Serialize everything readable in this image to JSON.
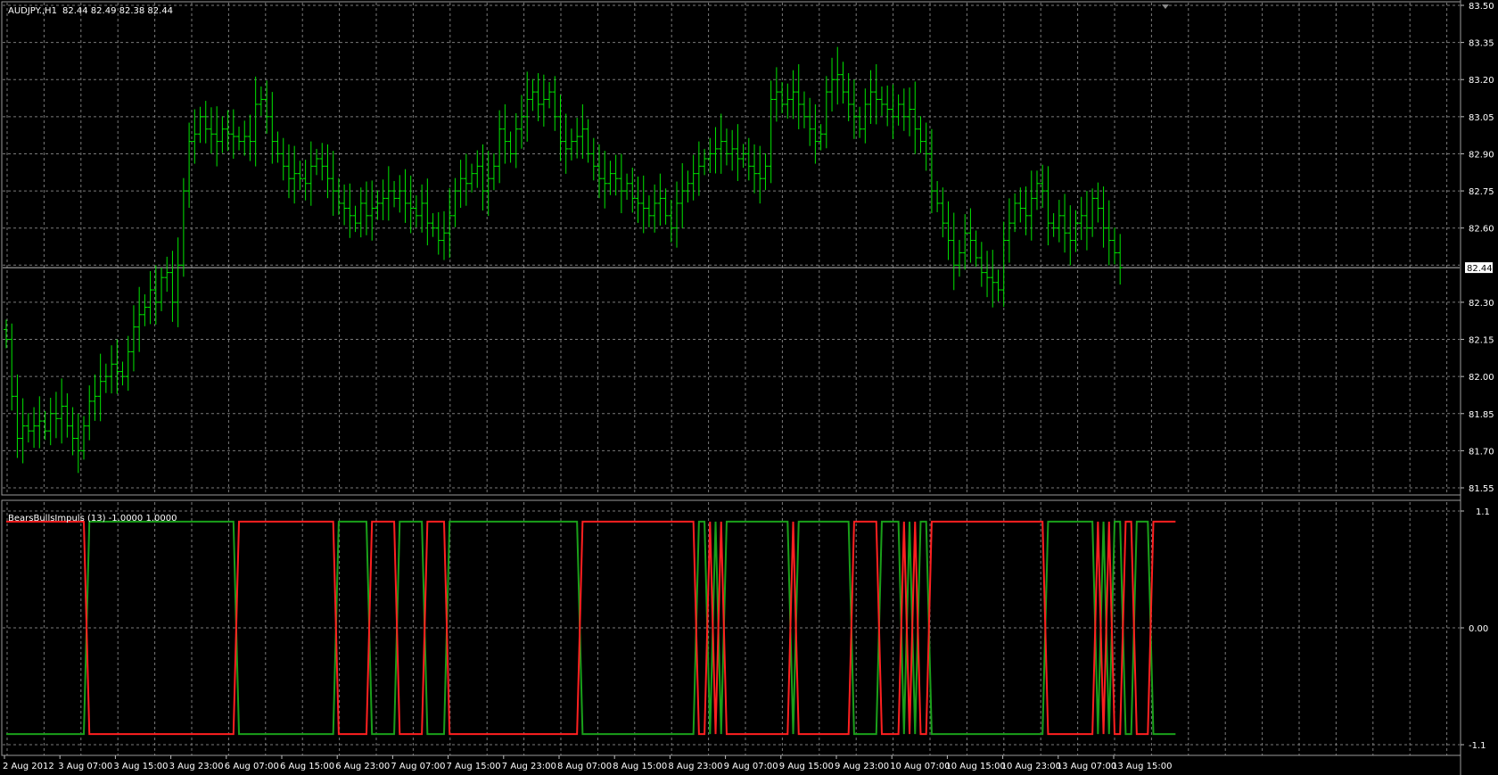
{
  "main_chart": {
    "symbol_header": "AUDJPY.,H1",
    "ohlc_header": "82.44 82.49 82.38 82.44",
    "current_price_label": "82.44",
    "y_ticks": [
      "83.50",
      "83.35",
      "83.20",
      "83.05",
      "82.90",
      "82.75",
      "82.60",
      "82.30",
      "82.15",
      "82.00",
      "81.85",
      "81.70",
      "81.55"
    ]
  },
  "indicator": {
    "header": "BearsBullsImpuls (13) -1.0000 1.0000",
    "y_ticks": [
      "1.1",
      "0.00",
      "-1.1"
    ]
  },
  "x_ticks": [
    "2 Aug 2012",
    "3 Aug 07:00",
    "3 Aug 15:00",
    "3 Aug 23:00",
    "6 Aug 07:00",
    "6 Aug 15:00",
    "6 Aug 23:00",
    "7 Aug 07:00",
    "7 Aug 15:00",
    "7 Aug 23:00",
    "8 Aug 07:00",
    "8 Aug 15:00",
    "8 Aug 23:00",
    "9 Aug 07:00",
    "9 Aug 15:00",
    "9 Aug 23:00",
    "10 Aug 07:00",
    "10 Aug 15:00",
    "10 Aug 23:00",
    "13 Aug 07:00",
    "13 Aug 15:00"
  ],
  "colors": {
    "background": "#000000",
    "grid": "#7a7a7a",
    "bars": "#00e600",
    "bulls_line": "#1aa01a",
    "bears_line": "#ff2020",
    "text": "#ffffff"
  },
  "chart_data": [
    {
      "type": "ohlc",
      "series": [
        {
          "name": "AUDJPY.,H1"
        }
      ],
      "x_unit": "hourly bars (index from 2 Aug 2012 23:00)",
      "ylim": [
        81.5,
        83.5
      ],
      "close": [
        82.15,
        81.92,
        81.75,
        81.8,
        81.78,
        81.8,
        81.82,
        81.78,
        81.85,
        81.83,
        81.88,
        81.8,
        81.75,
        81.7,
        81.8,
        81.9,
        81.92,
        81.98,
        82.0,
        82.05,
        82.02,
        82.0,
        82.1,
        82.2,
        82.25,
        82.28,
        82.35,
        82.3,
        82.4,
        82.42,
        82.3,
        82.45,
        82.75,
        82.95,
        82.98,
        83.05,
        83.0,
        82.98,
        82.95,
        83.0,
        82.98,
        82.97,
        82.95,
        82.97,
        82.95,
        83.1,
        83.12,
        83.05,
        82.95,
        82.9,
        82.85,
        82.8,
        82.82,
        82.8,
        82.78,
        82.85,
        82.88,
        82.85,
        82.8,
        82.75,
        82.7,
        82.68,
        82.65,
        82.62,
        82.7,
        82.65,
        82.68,
        82.7,
        82.72,
        82.75,
        82.72,
        82.75,
        82.7,
        82.68,
        82.65,
        82.7,
        82.62,
        82.6,
        82.55,
        82.58,
        82.65,
        82.75,
        82.8,
        82.78,
        82.82,
        82.85,
        82.75,
        82.8,
        82.85,
        83.0,
        82.95,
        82.9,
        83.0,
        83.05,
        83.12,
        83.15,
        83.1,
        83.12,
        83.15,
        83.05,
        82.95,
        82.92,
        82.95,
        82.97,
        83.0,
        82.9,
        82.85,
        82.8,
        82.78,
        82.82,
        82.8,
        82.75,
        82.78,
        82.72,
        82.7,
        82.68,
        82.65,
        82.7,
        82.72,
        82.65,
        82.6,
        82.7,
        82.75,
        82.78,
        82.82,
        82.85,
        82.88,
        82.9,
        82.92,
        82.95,
        82.9,
        82.92,
        82.88,
        82.9,
        82.85,
        82.82,
        82.8,
        82.85,
        83.12,
        83.15,
        83.1,
        83.12,
        83.15,
        83.1,
        83.05,
        83.0,
        82.95,
        82.98,
        83.15,
        83.2,
        83.22,
        83.15,
        83.1,
        83.05,
        83.0,
        83.1,
        83.15,
        83.12,
        83.1,
        83.08,
        83.05,
        83.1,
        83.05,
        83.08,
        83.0,
        82.95,
        82.9,
        82.75,
        82.7,
        82.62,
        82.55,
        82.45,
        82.5,
        82.58,
        82.55,
        82.48,
        82.42,
        82.4,
        82.38,
        82.35,
        82.55,
        82.62,
        82.7,
        82.68,
        82.65,
        82.72,
        82.78,
        82.75,
        82.62,
        82.6,
        82.65,
        82.58,
        82.55,
        82.62,
        82.65,
        82.6,
        82.72,
        82.68,
        82.6,
        82.55,
        82.5,
        82.44
      ]
    },
    {
      "type": "line",
      "title": "BearsBullsImpuls (13)",
      "ylim": [
        -1.1,
        1.1
      ],
      "x_unit": "hourly bars (index from 2 Aug 2012 23:00)",
      "series": [
        {
          "name": "bulls",
          "values": [
            -1,
            -1,
            -1,
            -1,
            -1,
            -1,
            -1,
            -1,
            -1,
            -1,
            -1,
            -1,
            -1,
            -1,
            -1,
            1,
            1,
            1,
            1,
            1,
            1,
            1,
            1,
            1,
            1,
            1,
            1,
            1,
            1,
            1,
            1,
            1,
            1,
            1,
            1,
            1,
            1,
            1,
            1,
            1,
            1,
            1,
            -1,
            -1,
            -1,
            -1,
            -1,
            -1,
            -1,
            -1,
            -1,
            -1,
            -1,
            -1,
            -1,
            -1,
            -1,
            -1,
            -1,
            -1,
            1,
            1,
            1,
            1,
            1,
            1,
            -1,
            -1,
            -1,
            -1,
            -1,
            1,
            1,
            1,
            1,
            1,
            -1,
            -1,
            -1,
            -1,
            1,
            1,
            1,
            1,
            1,
            1,
            1,
            1,
            1,
            1,
            1,
            1,
            1,
            1,
            1,
            1,
            1,
            1,
            1,
            1,
            1,
            1,
            1,
            1,
            -1,
            -1,
            -1,
            -1,
            -1,
            -1,
            -1,
            -1,
            -1,
            -1,
            -1,
            -1,
            -1,
            -1,
            -1,
            -1,
            -1,
            -1,
            -1,
            -1,
            -1,
            1,
            1,
            -1,
            1,
            -1,
            1,
            1,
            1,
            1,
            1,
            1,
            1,
            1,
            1,
            1,
            1,
            1,
            -1,
            1,
            1,
            1,
            1,
            1,
            1,
            1,
            1,
            1,
            1,
            -1,
            -1,
            -1,
            -1,
            -1,
            1,
            1,
            1,
            1,
            -1,
            1,
            -1,
            1,
            1,
            -1,
            -1,
            -1,
            -1,
            -1,
            -1,
            -1,
            -1,
            -1,
            -1,
            -1,
            -1,
            -1,
            -1,
            -1,
            -1,
            -1,
            -1,
            -1,
            -1,
            -1,
            1,
            1,
            1,
            1,
            1,
            1,
            1,
            1,
            1,
            -1,
            1,
            -1,
            1,
            1,
            -1,
            -1,
            1,
            1,
            1,
            -1,
            -1,
            -1,
            -1,
            -1
          ]
        },
        {
          "name": "bears",
          "values": [
            1,
            1,
            1,
            1,
            1,
            1,
            1,
            1,
            1,
            1,
            1,
            1,
            1,
            1,
            1,
            -1,
            -1,
            -1,
            -1,
            -1,
            -1,
            -1,
            -1,
            -1,
            -1,
            -1,
            -1,
            -1,
            -1,
            -1,
            -1,
            -1,
            -1,
            -1,
            -1,
            -1,
            -1,
            -1,
            -1,
            -1,
            -1,
            -1,
            1,
            1,
            1,
            1,
            1,
            1,
            1,
            1,
            1,
            1,
            1,
            1,
            1,
            1,
            1,
            1,
            1,
            1,
            -1,
            -1,
            -1,
            -1,
            -1,
            -1,
            1,
            1,
            1,
            1,
            1,
            -1,
            -1,
            -1,
            -1,
            -1,
            1,
            1,
            1,
            1,
            -1,
            -1,
            -1,
            -1,
            -1,
            -1,
            -1,
            -1,
            -1,
            -1,
            -1,
            -1,
            -1,
            -1,
            -1,
            -1,
            -1,
            -1,
            -1,
            -1,
            -1,
            -1,
            -1,
            -1,
            1,
            1,
            1,
            1,
            1,
            1,
            1,
            1,
            1,
            1,
            1,
            1,
            1,
            1,
            1,
            1,
            1,
            1,
            1,
            1,
            1,
            -1,
            -1,
            1,
            -1,
            1,
            -1,
            -1,
            -1,
            -1,
            -1,
            -1,
            -1,
            -1,
            -1,
            -1,
            -1,
            -1,
            1,
            -1,
            -1,
            -1,
            -1,
            -1,
            -1,
            -1,
            -1,
            -1,
            -1,
            1,
            1,
            1,
            1,
            1,
            -1,
            -1,
            -1,
            -1,
            1,
            -1,
            1,
            -1,
            -1,
            1,
            1,
            1,
            1,
            1,
            1,
            1,
            1,
            1,
            1,
            1,
            1,
            1,
            1,
            1,
            1,
            1,
            1,
            1,
            1,
            1,
            -1,
            -1,
            -1,
            -1,
            -1,
            -1,
            -1,
            -1,
            -1,
            1,
            -1,
            1,
            -1,
            -1,
            1,
            1,
            -1,
            -1,
            -1,
            1,
            1,
            1,
            1,
            1
          ]
        }
      ]
    }
  ]
}
